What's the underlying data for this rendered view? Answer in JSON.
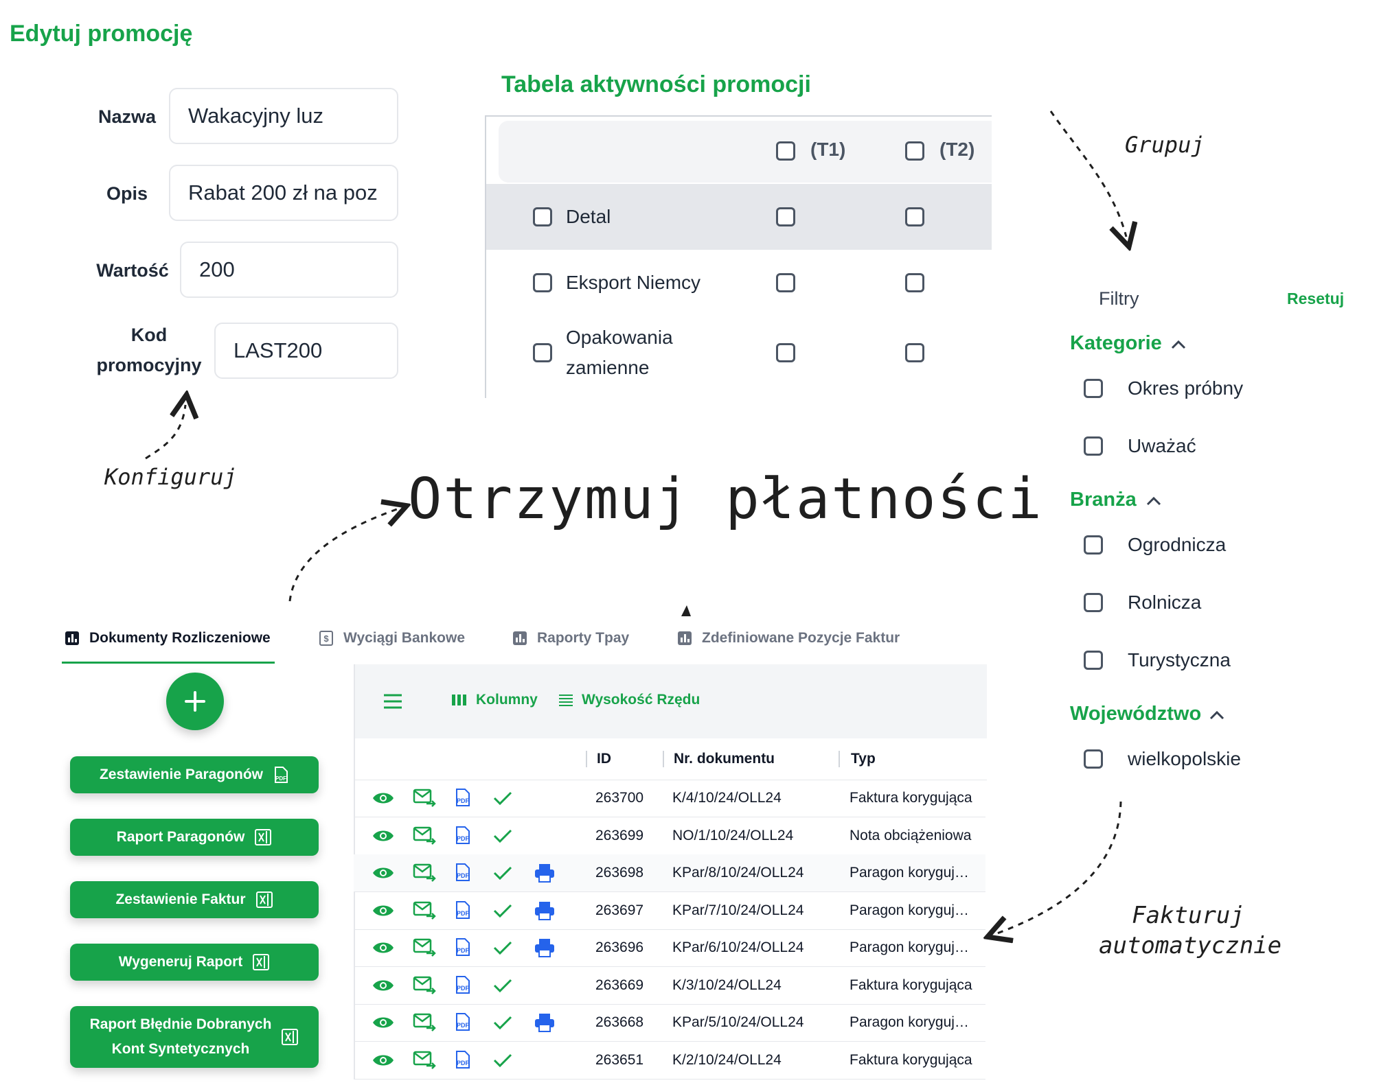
{
  "edit": {
    "title": "Edytuj promocję",
    "fields": [
      {
        "label": "Nazwa",
        "value": "Wakacyjny luz"
      },
      {
        "label": "Opis",
        "value": "Rabat 200 zł na poz"
      },
      {
        "label": "Wartość",
        "value": "200"
      },
      {
        "label_line1": "Kod",
        "label_line2": "promocyjny",
        "value": "LAST200"
      }
    ]
  },
  "activity": {
    "title": "Tabela aktywności promocji",
    "columns": [
      "(T1)",
      "(T2)"
    ],
    "rows": [
      {
        "label": "Detal"
      },
      {
        "label": "Eksport Niemcy"
      },
      {
        "label_line1": "Opakowania",
        "label_line2": "zamienne"
      }
    ]
  },
  "annotations": {
    "grupuj": "Grupuj",
    "konfiguruj": "Konfiguruj",
    "headline": "Otrzymuj płatności",
    "fakturuj_line1": "Fakturuj",
    "fakturuj_line2": "automatycznie"
  },
  "filters": {
    "title": "Filtry",
    "reset": "Resetuj",
    "sections": [
      {
        "title": "Kategorie",
        "items": [
          "Okres próbny",
          "Uważać"
        ]
      },
      {
        "title": "Branża",
        "items": [
          "Ogrodnicza",
          "Rolnicza",
          "Turystyczna"
        ]
      },
      {
        "title": "Województwo",
        "items": [
          "wielkopolskie"
        ]
      }
    ]
  },
  "tabs": [
    {
      "label": "Dokumenty Rozliczeniowe",
      "icon": "chart-icon",
      "active": true
    },
    {
      "label": "Wyciągi Bankowe",
      "icon": "dollar-doc-icon",
      "active": false
    },
    {
      "label": "Raporty Tpay",
      "icon": "chart-icon",
      "active": false
    },
    {
      "label": "Zdefiniowane Pozycje Faktur",
      "icon": "chart-icon",
      "active": false
    }
  ],
  "actions": {
    "buttons": [
      {
        "label": "Zestawienie Paragonów",
        "icon": "pdf-icon"
      },
      {
        "label": "Raport Paragonów",
        "icon": "excel-icon"
      },
      {
        "label": "Zestawienie Faktur",
        "icon": "excel-icon"
      },
      {
        "label": "Wygeneruj Raport",
        "icon": "excel-icon"
      },
      {
        "label_line1": "Raport Błędnie Dobranych",
        "label_line2": "Kont Syntetycznych",
        "icon": "excel-icon"
      }
    ]
  },
  "grid": {
    "toolbar": {
      "columns": "Kolumny",
      "row_height": "Wysokość Rzędu"
    },
    "headers": {
      "id": "ID",
      "doc": "Nr. dokumentu",
      "type": "Typ"
    },
    "rows": [
      {
        "id": "263700",
        "doc": "K/4/10/24/OLL24",
        "type": "Faktura korygująca",
        "print": false
      },
      {
        "id": "263699",
        "doc": "NO/1/10/24/OLL24",
        "type": "Nota obciążeniowa",
        "print": false
      },
      {
        "id": "263698",
        "doc": "KPar/8/10/24/OLL24",
        "type": "Paragon koryguj…",
        "print": true
      },
      {
        "id": "263697",
        "doc": "KPar/7/10/24/OLL24",
        "type": "Paragon koryguj…",
        "print": true
      },
      {
        "id": "263696",
        "doc": "KPar/6/10/24/OLL24",
        "type": "Paragon koryguj…",
        "print": true
      },
      {
        "id": "263669",
        "doc": "K/3/10/24/OLL24",
        "type": "Faktura korygująca",
        "print": false
      },
      {
        "id": "263668",
        "doc": "KPar/5/10/24/OLL24",
        "type": "Paragon koryguj…",
        "print": true
      },
      {
        "id": "263651",
        "doc": "K/2/10/24/OLL24",
        "type": "Faktura korygująca",
        "print": false
      }
    ]
  },
  "colors": {
    "accent": "#17a34a",
    "icon_blue": "#2563eb"
  }
}
